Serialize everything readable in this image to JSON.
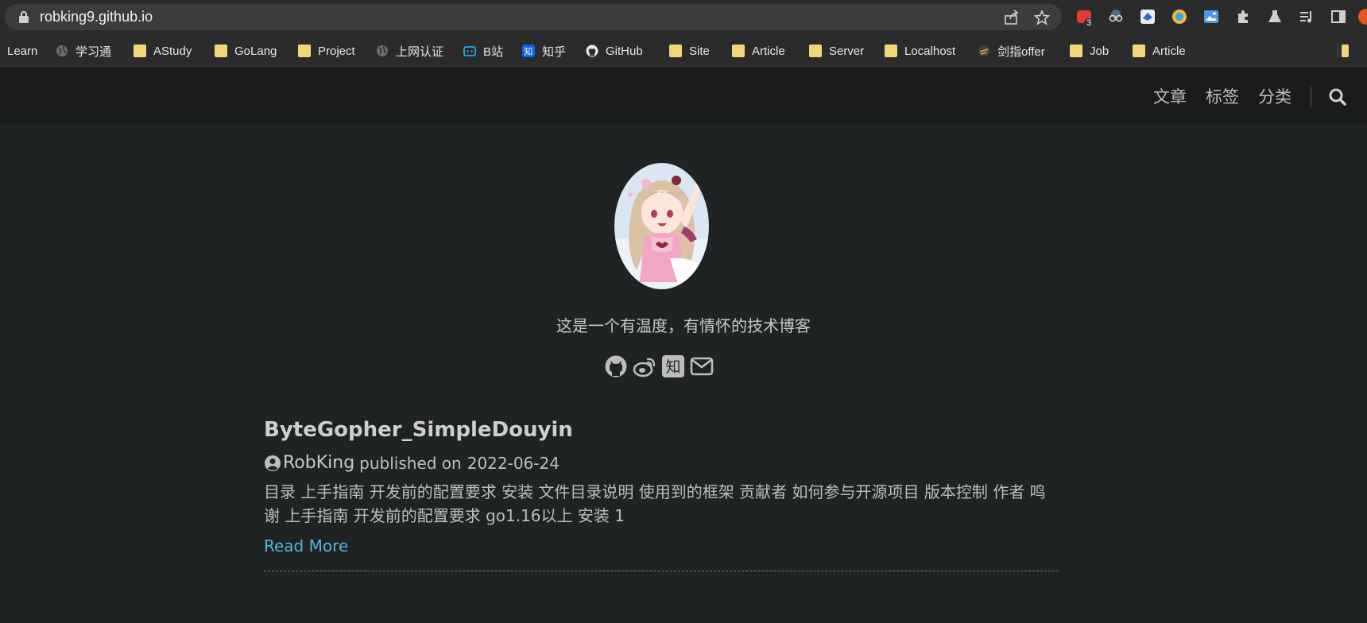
{
  "browser": {
    "url": "robking9.github.io",
    "extension_badge": "3",
    "bookmarks": [
      {
        "label": "Learn",
        "icon": "none"
      },
      {
        "label": "学习通",
        "icon": "globe-icon"
      },
      {
        "label": "AStudy",
        "icon": "folder-icon"
      },
      {
        "label": "GoLang",
        "icon": "folder-icon"
      },
      {
        "label": "Project",
        "icon": "folder-icon"
      },
      {
        "label": "上网认证",
        "icon": "globe-icon"
      },
      {
        "label": "B站",
        "icon": "bilibili-icon"
      },
      {
        "label": "知乎",
        "icon": "zhihu-icon"
      },
      {
        "label": "GitHub",
        "icon": "github-icon"
      },
      {
        "label": "Site",
        "icon": "folder-icon"
      },
      {
        "label": "Article",
        "icon": "folder-icon"
      },
      {
        "label": "Server",
        "icon": "folder-icon"
      },
      {
        "label": "Localhost",
        "icon": "folder-icon"
      },
      {
        "label": "剑指offer",
        "icon": "site-icon"
      },
      {
        "label": "Job",
        "icon": "folder-icon"
      },
      {
        "label": "Article",
        "icon": "folder-icon"
      }
    ]
  },
  "site": {
    "nav": {
      "articles": "文章",
      "tags": "标签",
      "categories": "分类"
    },
    "tagline": "这是一个有温度，有情怀的技术博客",
    "zhihu_glyph": "知"
  },
  "post": {
    "title": "ByteGopher_SimpleDouyin",
    "author": "RobKing",
    "published_prefix": "published on",
    "date": "2022-06-24",
    "excerpt": "目录 上手指南 开发前的配置要求 安装 文件目录说明 使用到的框架 贡献者 如何参与开源项目 版本控制 作者 鸣谢 上手指南 开发前的配置要求 go1.16以上 安装 1",
    "read_more": "Read More"
  },
  "colors": {
    "page_bg": "#202324",
    "header_bg": "#1a1b1c",
    "link": "#4fb3e6",
    "folder": "#f3d57a"
  }
}
